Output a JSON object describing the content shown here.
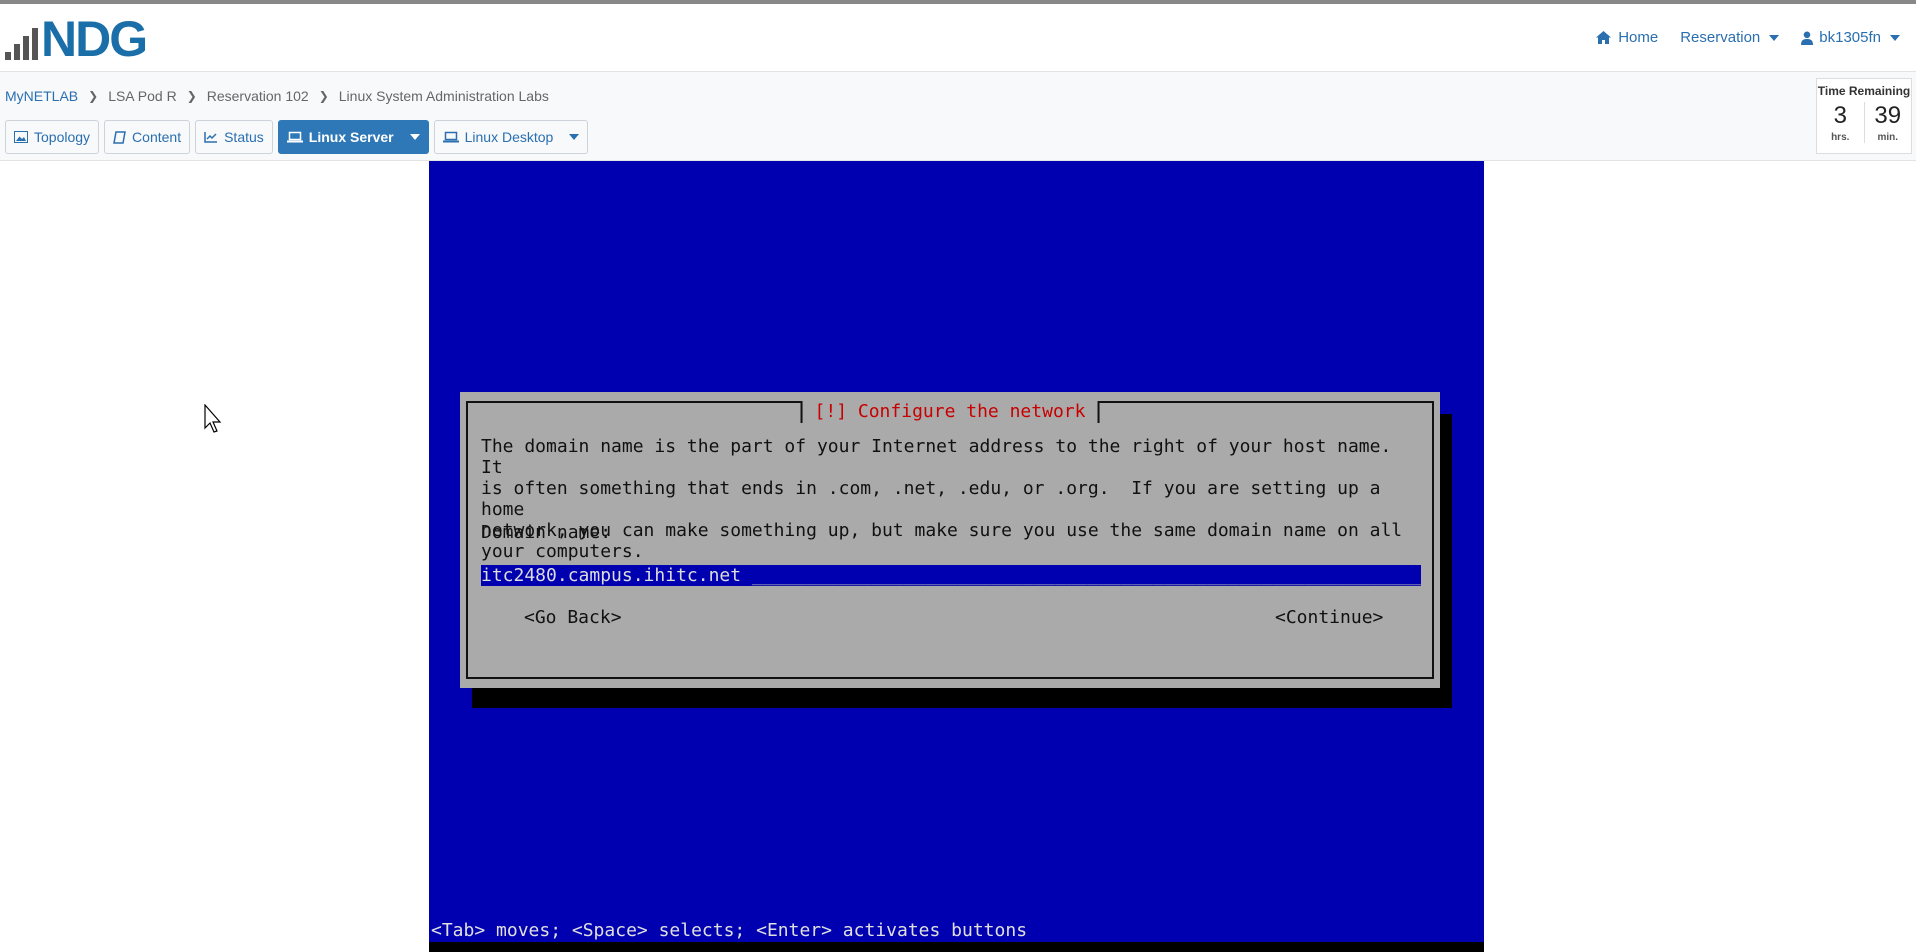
{
  "nav": {
    "logo_text": "NDG",
    "links": [
      {
        "label": "Home",
        "icon": "home-icon"
      },
      {
        "label": "Reservation",
        "icon": null,
        "dropdown": true
      },
      {
        "label": "bk1305fn",
        "icon": "user-icon",
        "dropdown": true
      }
    ]
  },
  "breadcrumb": [
    "MyNETLAB",
    "LSA Pod R",
    "Reservation 102",
    "Linux System Administration Labs"
  ],
  "tabs": [
    {
      "label": "Topology",
      "icon": "image-icon"
    },
    {
      "label": "Content",
      "icon": "book-icon"
    },
    {
      "label": "Status",
      "icon": "line-chart-icon"
    },
    {
      "label": "Linux Server",
      "icon": "laptop-icon",
      "active": true,
      "dropdown": true
    },
    {
      "label": "Linux Desktop",
      "icon": "laptop-icon",
      "dropdown": true
    }
  ],
  "time_remaining": {
    "title": "Time Remaining",
    "hours": "3",
    "hours_unit": "hrs.",
    "minutes": "39",
    "minutes_unit": "min."
  },
  "console": {
    "dialog_title": "[!] Configure the network",
    "body": "The domain name is the part of your Internet address to the right of your host name.  It\nis often something that ends in .com, .net, .edu, or .org.  If you are setting up a home\nnetwork, you can make something up, but make sure you use the same domain name on all\nyour computers.",
    "field_label": "Domain name:",
    "field_value": "itc2480.campus.ihitc.net",
    "go_back": "<Go Back>",
    "continue": "<Continue>",
    "status_line": "<Tab> moves; <Space> selects; <Enter> activates buttons"
  },
  "colors": {
    "console_bg": "#0000b0",
    "dialog_bg": "#aaaaaa",
    "title_red": "#c80000",
    "brand_blue": "#2a6fb0"
  }
}
